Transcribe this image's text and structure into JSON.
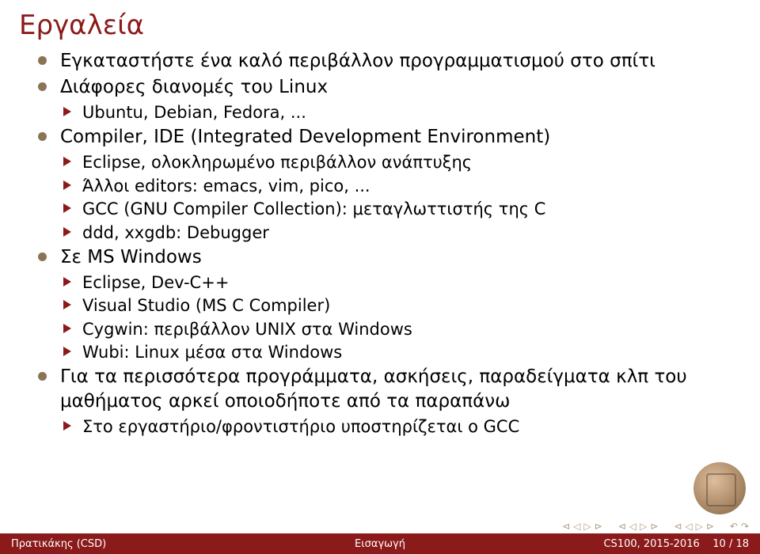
{
  "title": "Εργαλεία",
  "bullets": {
    "b1": "Εγκαταστήστε ένα καλό περιβάλλον προγραμματισμού στο σπίτι",
    "b2": "Διάφορες διανομές του Linux",
    "b2a": "Ubuntu, Debian, Fedora, ...",
    "b3": "Compiler, IDE (Integrated Development Environment)",
    "b3a": "Eclipse, ολοκληρωμένο περιβάλλον ανάπτυξης",
    "b3b": "Άλλοι editors: emacs, vim, pico, ...",
    "b3c": "GCC (GNU Compiler Collection): μεταγλωττιστής της C",
    "b3d": "ddd, xxgdb: Debugger",
    "b4": "Σε MS Windows",
    "b4a": "Eclipse, Dev-C++",
    "b4b": "Visual Studio (MS C Compiler)",
    "b4c": "Cygwin: περιβάλλον UNIX στα Windows",
    "b4d": "Wubi: Linux μέσα στα Windows",
    "b5": "Για τα περισσότερα προγράμματα, ασκήσεις, παραδείγματα κλπ του μαθήματος αρκεί οποιοδήποτε από τα παραπάνω",
    "b5a": "Στο εργαστήριο/φροντιστήριο υποστηρίζεται ο GCC"
  },
  "footer": {
    "left": "Πρατικάκης (CSD)",
    "center": "Εισαγωγή",
    "right": "CS100, 2015-2016",
    "page": "10 / 18"
  },
  "nav_icons": {
    "first": "⊲",
    "prev": "◁",
    "next": "▷",
    "last": "⊳",
    "back": "↶",
    "fwd": "↷"
  }
}
